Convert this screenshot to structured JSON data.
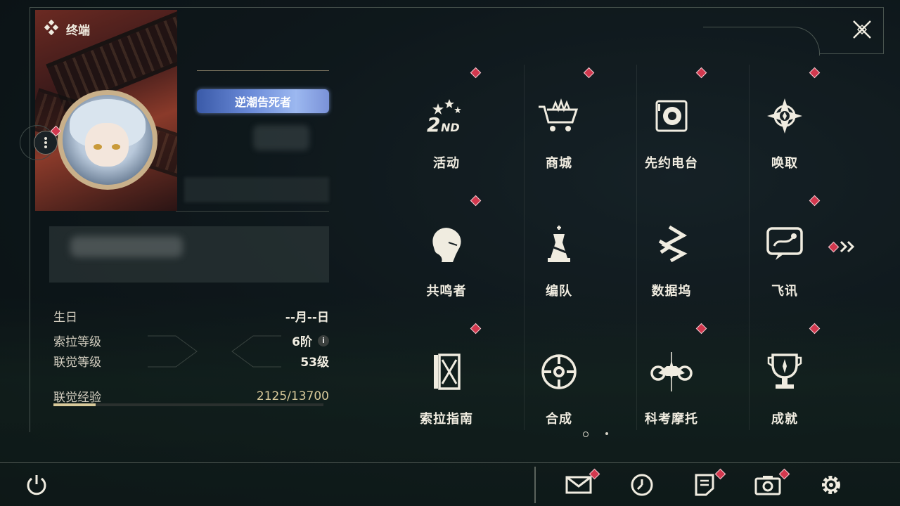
{
  "header": {
    "title": "终端",
    "title_icon": "diamond-cluster-icon",
    "close_icon": "close-x-icon"
  },
  "profile": {
    "title_tag": "逆潮告死者",
    "birthday_label": "生日",
    "birthday_value": "--月--日",
    "sola_level_label": "索拉等级",
    "sola_level_value": "6阶",
    "union_level_label": "联觉等级",
    "union_level_value": "53级",
    "union_exp_label": "联觉经验",
    "union_exp_value": "2125/13700",
    "union_exp_fraction": 0.155
  },
  "grid": {
    "items": [
      {
        "label": "活动",
        "icon": "events-2nd-hd-icon",
        "badge": true
      },
      {
        "label": "商城",
        "icon": "shop-cart-icon",
        "badge": true
      },
      {
        "label": "先约电台",
        "icon": "radio-pass-icon",
        "badge": true
      },
      {
        "label": "唤取",
        "icon": "convene-compass-icon",
        "badge": true
      },
      {
        "label": "共鸣者",
        "icon": "resonator-portrait-icon",
        "badge": true
      },
      {
        "label": "编队",
        "icon": "team-chess-icon",
        "badge": false
      },
      {
        "label": "数据坞",
        "icon": "data-bank-icon",
        "badge": false
      },
      {
        "label": "飞讯",
        "icon": "chat-message-icon",
        "badge": true
      },
      {
        "label": "索拉指南",
        "icon": "guide-book-icon",
        "badge": true
      },
      {
        "label": "合成",
        "icon": "synthesis-icon",
        "badge": false
      },
      {
        "label": "科考摩托",
        "icon": "motorcycle-icon",
        "badge": true
      },
      {
        "label": "成就",
        "icon": "achievement-trophy-icon",
        "badge": true
      }
    ],
    "page_count": 2,
    "current_page": 1
  },
  "bottom_bar": {
    "power_icon": "power-icon",
    "items": [
      "mail-icon",
      "clock-icon",
      "notice-icon",
      "camera-icon",
      "settings-gear-icon"
    ]
  },
  "colors": {
    "badge": "#d2384e",
    "exp_fill": "#d8c99a",
    "text": "#f0ece0"
  }
}
